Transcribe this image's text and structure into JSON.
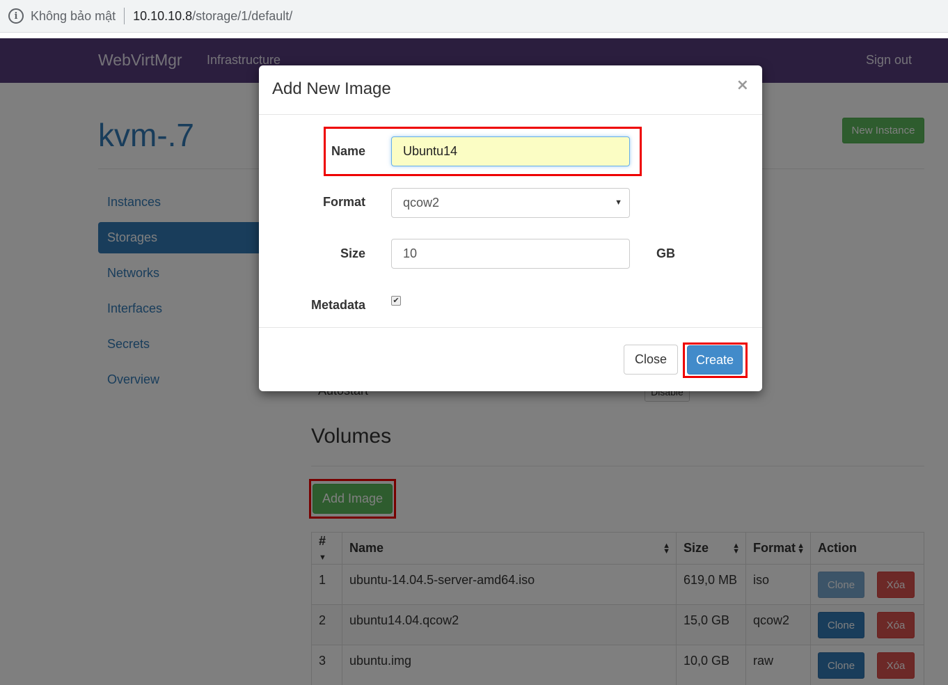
{
  "browser": {
    "security_label": "Không bảo mật",
    "url_host": "10.10.10.8",
    "url_path": "/storage/1/default/"
  },
  "navbar": {
    "brand": "WebVirtMgr",
    "infrastructure": "Infrastructure",
    "sign_out": "Sign out"
  },
  "host": {
    "title": "kvm-.7",
    "new_instance": "New Instance"
  },
  "sidebar": {
    "items": [
      {
        "label": "Instances"
      },
      {
        "label": "Storages"
      },
      {
        "label": "Networks"
      },
      {
        "label": "Interfaces"
      },
      {
        "label": "Secrets"
      },
      {
        "label": "Overview"
      }
    ],
    "active": "Storages"
  },
  "storage": {
    "autostart_label": "Autostart",
    "disable_button": "Disable"
  },
  "volumes": {
    "heading": "Volumes",
    "add_image": "Add Image",
    "columns": [
      "#",
      "Name",
      "Size",
      "Format",
      "Action"
    ],
    "rows": [
      {
        "num": "1",
        "name": "ubuntu-14.04.5-server-amd64.iso",
        "size": "619,0 MB",
        "format": "iso",
        "clone": "Clone",
        "delete": "Xóa"
      },
      {
        "num": "2",
        "name": "ubuntu14.04.qcow2",
        "size": "15,0 GB",
        "format": "qcow2",
        "clone": "Clone",
        "delete": "Xóa"
      },
      {
        "num": "3",
        "name": "ubuntu.img",
        "size": "10,0 GB",
        "format": "raw",
        "clone": "Clone",
        "delete": "Xóa"
      }
    ]
  },
  "modal": {
    "title": "Add New Image",
    "close_x": "×",
    "name_label": "Name",
    "name_value": "Ubuntu14",
    "format_label": "Format",
    "format_value": "qcow2",
    "size_label": "Size",
    "size_value": "10",
    "size_unit": "GB",
    "metadata_label": "Metadata",
    "metadata_checked": true,
    "close_button": "Close",
    "create_button": "Create"
  },
  "colors": {
    "navbar": "#563d7c",
    "primary": "#337ab7",
    "success": "#5cb85c",
    "danger": "#d9534f",
    "highlight": "#ee0000"
  }
}
